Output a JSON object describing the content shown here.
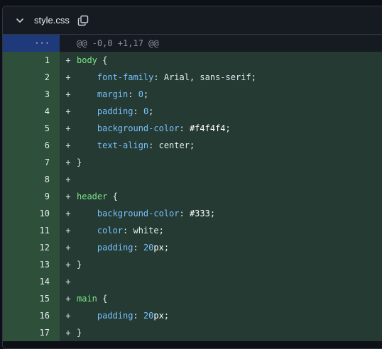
{
  "file": {
    "name": "style.css",
    "collapse_icon": "chevron-down-icon",
    "copy_icon": "copy-icon"
  },
  "hunk": {
    "expander": "···",
    "header": "@@ -0,0 +1,17 @@"
  },
  "lines": [
    {
      "n": "1",
      "marker": "+",
      "indent": "",
      "a": "body",
      "b": " {",
      "kind": "sel"
    },
    {
      "n": "2",
      "marker": "+",
      "indent": "    ",
      "a": "font-family",
      "b": ": Arial, sans-serif;",
      "kind": "decl"
    },
    {
      "n": "3",
      "marker": "+",
      "indent": "    ",
      "a": "margin",
      "b": ": ",
      "v": "0",
      "u": "",
      "e": ";",
      "kind": "numdecl"
    },
    {
      "n": "4",
      "marker": "+",
      "indent": "    ",
      "a": "padding",
      "b": ": ",
      "v": "0",
      "u": "",
      "e": ";",
      "kind": "numdecl"
    },
    {
      "n": "5",
      "marker": "+",
      "indent": "    ",
      "a": "background-color",
      "b": ": ",
      "v": "#f4f4f4",
      "u": "",
      "e": ";",
      "kind": "numdecl"
    },
    {
      "n": "6",
      "marker": "+",
      "indent": "    ",
      "a": "text-align",
      "b": ": center;",
      "kind": "decl"
    },
    {
      "n": "7",
      "marker": "+",
      "indent": "",
      "a": "",
      "b": "}",
      "kind": "close"
    },
    {
      "n": "8",
      "marker": "+",
      "indent": "",
      "a": "",
      "b": "",
      "kind": "blank"
    },
    {
      "n": "9",
      "marker": "+",
      "indent": "",
      "a": "header",
      "b": " {",
      "kind": "sel"
    },
    {
      "n": "10",
      "marker": "+",
      "indent": "    ",
      "a": "background-color",
      "b": ": ",
      "v": "#333",
      "u": "",
      "e": ";",
      "kind": "numdecl"
    },
    {
      "n": "11",
      "marker": "+",
      "indent": "    ",
      "a": "color",
      "b": ": white;",
      "kind": "decl"
    },
    {
      "n": "12",
      "marker": "+",
      "indent": "    ",
      "a": "padding",
      "b": ": ",
      "v": "20",
      "u": "px",
      "e": ";",
      "kind": "numdecl"
    },
    {
      "n": "13",
      "marker": "+",
      "indent": "",
      "a": "",
      "b": "}",
      "kind": "close"
    },
    {
      "n": "14",
      "marker": "+",
      "indent": "",
      "a": "",
      "b": "",
      "kind": "blank"
    },
    {
      "n": "15",
      "marker": "+",
      "indent": "",
      "a": "main",
      "b": " {",
      "kind": "sel"
    },
    {
      "n": "16",
      "marker": "+",
      "indent": "    ",
      "a": "padding",
      "b": ": ",
      "v": "20",
      "u": "px",
      "e": ";",
      "kind": "numdecl"
    },
    {
      "n": "17",
      "marker": "+",
      "indent": "",
      "a": "",
      "b": "}",
      "kind": "close"
    }
  ]
}
